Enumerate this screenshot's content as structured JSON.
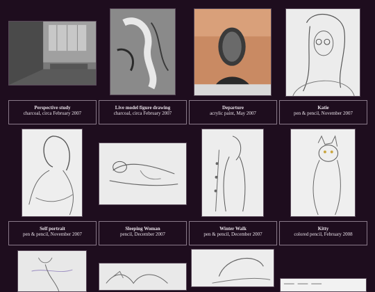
{
  "row1": [
    {
      "title": "Perspective study",
      "subtitle": "charcoal, circa February 2007"
    },
    {
      "title": "Live model figure drawing",
      "subtitle": "charcoal, circa February 2007"
    },
    {
      "title": "Departure",
      "subtitle": "acrylic paint, May 2007"
    },
    {
      "title": "Katie",
      "subtitle": "pen & pencil, November 2007"
    }
  ],
  "row2": [
    {
      "title": "Self portrait",
      "subtitle": "pen & pencil, November 2007"
    },
    {
      "title": "Sleeping Woman",
      "subtitle": "pencil, December 2007"
    },
    {
      "title": "Winter Walk",
      "subtitle": "pen & pencil, December 2007"
    },
    {
      "title": "Kitty",
      "subtitle": "colored pencil, February 2008"
    }
  ],
  "colors": {
    "background": "#1e0d1e",
    "caption_border": "#8a7a8a",
    "caption_text": "#e9e1e9"
  },
  "icons": [
    "artwork-thumbnail"
  ]
}
